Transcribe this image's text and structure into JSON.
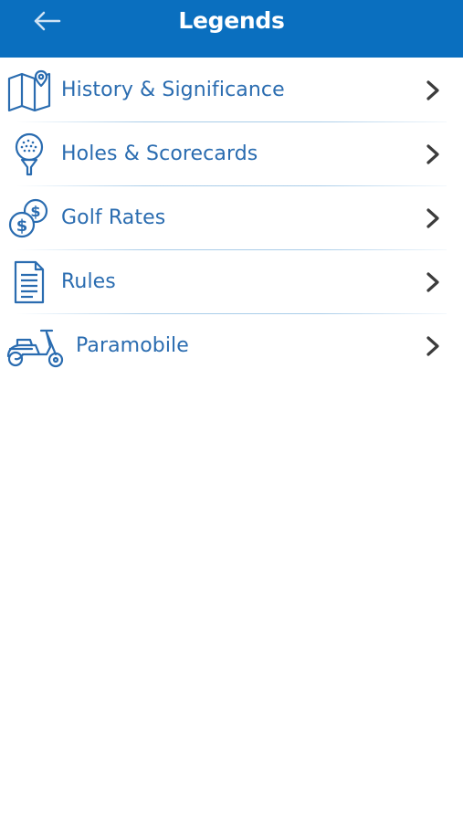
{
  "header": {
    "title": "Legends"
  },
  "menu": {
    "items": [
      {
        "label": "History & Significance",
        "icon": "map-pin-icon"
      },
      {
        "label": "Holes & Scorecards",
        "icon": "golf-ball-tee-icon"
      },
      {
        "label": "Golf Rates",
        "icon": "coins-icon"
      },
      {
        "label": "Rules",
        "icon": "document-icon"
      },
      {
        "label": "Paramobile",
        "icon": "scooter-icon"
      }
    ]
  },
  "colors": {
    "header_bg": "#0a6fbf",
    "label": "#2a6cb0",
    "chevron": "#3c3c3c"
  }
}
